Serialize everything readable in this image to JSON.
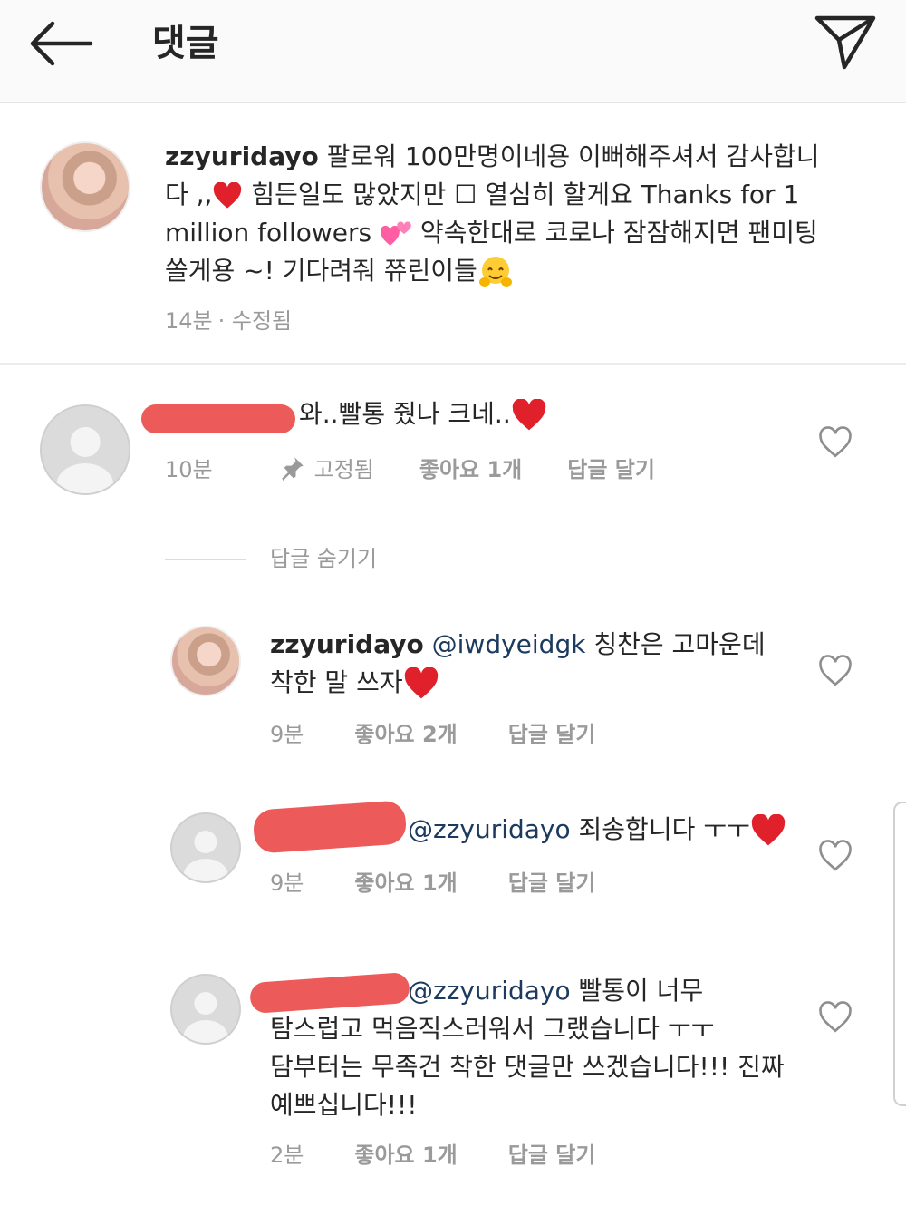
{
  "header": {
    "title": "댓글"
  },
  "caption": {
    "username": "zzyuridayo",
    "text_1": " 팔로워 100만명이네용 이뻐해주셔서 감사합니다 ,,",
    "text_2": " 힘든일도 많았지만 ☐ 열심히 할게요 Thanks for 1 million followers ",
    "text_3": " 약속한대로 코로나 잠잠해지면 팬미팅 쏠게용 ~! 기다려줘 쮸린이들",
    "time": "14분",
    "edited": "· 수정됨"
  },
  "comments": [
    {
      "text": "와..빨통 줬나 크네..",
      "time": "10분",
      "pinned": "고정됨",
      "likes": "좋아요 1개",
      "reply": "답글 달기"
    }
  ],
  "hide_replies": "답글 숨기기",
  "replies": [
    {
      "username": "zzyuridayo",
      "mention": "@iwdyeidgk",
      "text_1": " 칭찬은 고마운데",
      "text_2": "착한 말 쓰자",
      "time": "9분",
      "likes": "좋아요 2개",
      "reply": "답글 달기"
    },
    {
      "mention": "@zzyuridayo",
      "text": " 죄송합니다 ㅜㅜ",
      "time": "9분",
      "likes": "좋아요 1개",
      "reply": "답글 달기"
    },
    {
      "mention": "@zzyuridayo",
      "text_1": " 빨통이 너무",
      "text_2": "탐스럽고 먹음직스러워서 그랬습니다 ㅜㅜ",
      "text_3": "담부터는 무족건 착한 댓글만 쓰겠습니다!!! 진짜",
      "text_4": "예쁘십니다!!!",
      "time": "2분",
      "likes": "좋아요 1개",
      "reply": "답글 달기"
    }
  ],
  "icons": {
    "back": "back-arrow-icon",
    "send": "send-icon",
    "heart_emoji": "red-heart-emoji",
    "two_hearts_emoji": "two-hearts-emoji",
    "hug_emoji": "hugging-face-emoji",
    "pin": "pin-icon",
    "like": "heart-outline-icon"
  },
  "colors": {
    "mention": "#1b3a5e",
    "meta": "#9a9a9a",
    "redaction": "#ec5a5a",
    "header_bg": "#fafafa"
  }
}
